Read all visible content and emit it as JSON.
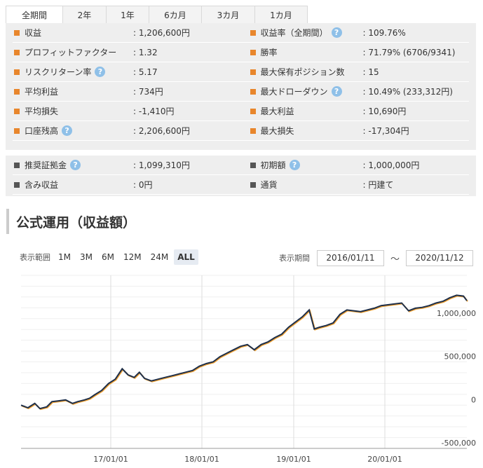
{
  "tabs": [
    {
      "label": "全期間",
      "active": true
    },
    {
      "label": "2年",
      "active": false
    },
    {
      "label": "1年",
      "active": false
    },
    {
      "label": "6カ月",
      "active": false
    },
    {
      "label": "3カ月",
      "active": false
    },
    {
      "label": "1カ月",
      "active": false
    }
  ],
  "stats": {
    "rows": [
      {
        "left": {
          "label": "収益",
          "value": ": 1,206,600円"
        },
        "right": {
          "label": "収益率（全期間）",
          "value": ": 109.76%"
        }
      },
      {
        "left": {
          "label": "プロフィットファクター",
          "value": ": 1.32"
        },
        "right": {
          "label": "勝率",
          "value": ": 71.79% (6706/9341)"
        }
      },
      {
        "left": {
          "label": "リスクリターン率",
          "value": ": 5.17"
        },
        "right": {
          "label": "最大保有ポジション数",
          "value": ": 15"
        }
      },
      {
        "left": {
          "label": "平均利益",
          "value": ": 734円"
        },
        "right": {
          "label": "最大ドローダウン",
          "value": ": 10.49% (233,312円)"
        }
      },
      {
        "left": {
          "label": "平均損失",
          "value": ": -1,410円"
        },
        "right": {
          "label": "最大利益",
          "value": ": 10,690円"
        }
      },
      {
        "left": {
          "label": "口座残高",
          "value": ": 2,206,600円"
        },
        "right": {
          "label": "最大損失",
          "value": ": -17,304円"
        }
      }
    ]
  },
  "account": {
    "rows": [
      {
        "left": {
          "label": "推奨証拠金",
          "value": ": 1,099,310円"
        },
        "right": {
          "label": "初期額",
          "value": ": 1,000,000円"
        }
      },
      {
        "left": {
          "label": "含み収益",
          "value": ": 0円"
        },
        "right": {
          "label": "通貨",
          "value": ": 円建て"
        }
      }
    ]
  },
  "section_title": "公式運用（収益額）",
  "range": {
    "label": "表示範囲",
    "buttons": [
      "1M",
      "3M",
      "6M",
      "12M",
      "24M",
      "ALL"
    ],
    "active": "ALL"
  },
  "period": {
    "label": "表示期間",
    "from": "2016/01/11",
    "tilde": "〜",
    "to": "2020/11/12"
  },
  "help_glyph": "?",
  "colors": {
    "accent_orange": "#e8862c",
    "line": "#1e2f4a",
    "line_shadow": "#f0a030",
    "panel_bg": "#eeeeee"
  },
  "chart_data": {
    "type": "line",
    "x_ticks": [
      "17/01/01",
      "18/01/01",
      "19/01/01",
      "20/01/01"
    ],
    "y_ticks": [
      -500000,
      0,
      500000,
      1000000
    ],
    "y_tick_labels": [
      "-500,000",
      "0",
      "500,000",
      "1,000,000"
    ],
    "ylim": [
      -500000,
      1500000
    ],
    "x_start": "2016/01/11",
    "x_end": "2020/11/12",
    "series": [
      {
        "values": [
          [
            0,
            0
          ],
          [
            20,
            -30000
          ],
          [
            40,
            20000
          ],
          [
            55,
            -40000
          ],
          [
            75,
            -20000
          ],
          [
            90,
            40000
          ],
          [
            110,
            50000
          ],
          [
            130,
            60000
          ],
          [
            150,
            20000
          ],
          [
            165,
            40000
          ],
          [
            185,
            60000
          ],
          [
            200,
            80000
          ],
          [
            215,
            120000
          ],
          [
            235,
            170000
          ],
          [
            255,
            250000
          ],
          [
            275,
            300000
          ],
          [
            295,
            420000
          ],
          [
            312,
            350000
          ],
          [
            330,
            320000
          ],
          [
            345,
            380000
          ],
          [
            360,
            310000
          ],
          [
            380,
            280000
          ],
          [
            400,
            300000
          ],
          [
            420,
            320000
          ],
          [
            440,
            340000
          ],
          [
            460,
            360000
          ],
          [
            480,
            380000
          ],
          [
            500,
            400000
          ],
          [
            520,
            450000
          ],
          [
            540,
            480000
          ],
          [
            560,
            500000
          ],
          [
            580,
            560000
          ],
          [
            600,
            600000
          ],
          [
            620,
            640000
          ],
          [
            640,
            680000
          ],
          [
            660,
            700000
          ],
          [
            680,
            640000
          ],
          [
            700,
            700000
          ],
          [
            720,
            730000
          ],
          [
            740,
            780000
          ],
          [
            760,
            820000
          ],
          [
            780,
            900000
          ],
          [
            800,
            960000
          ],
          [
            820,
            1020000
          ],
          [
            840,
            1100000
          ],
          [
            855,
            880000
          ],
          [
            870,
            900000
          ],
          [
            890,
            920000
          ],
          [
            910,
            950000
          ],
          [
            930,
            1050000
          ],
          [
            950,
            1100000
          ],
          [
            970,
            1090000
          ],
          [
            990,
            1080000
          ],
          [
            1010,
            1100000
          ],
          [
            1030,
            1120000
          ],
          [
            1050,
            1150000
          ],
          [
            1070,
            1160000
          ],
          [
            1090,
            1170000
          ],
          [
            1110,
            1180000
          ],
          [
            1130,
            1090000
          ],
          [
            1150,
            1120000
          ],
          [
            1170,
            1130000
          ],
          [
            1190,
            1150000
          ],
          [
            1210,
            1180000
          ],
          [
            1230,
            1200000
          ],
          [
            1250,
            1240000
          ],
          [
            1270,
            1270000
          ],
          [
            1290,
            1260000
          ],
          [
            1300,
            1206600
          ]
        ]
      }
    ]
  }
}
